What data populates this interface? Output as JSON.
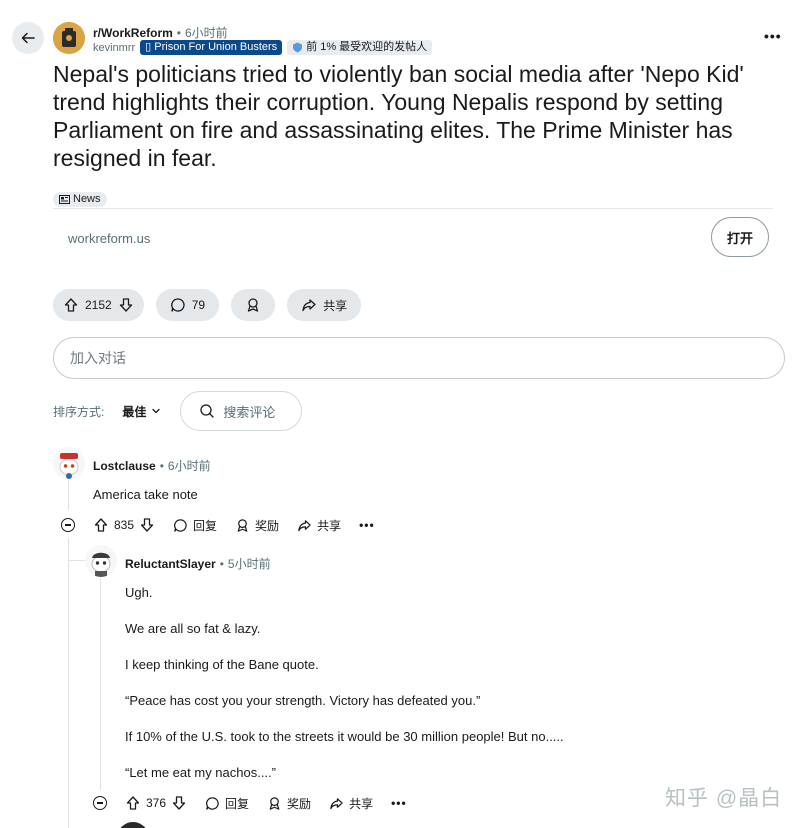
{
  "header": {
    "subreddit": "r/WorkReform",
    "separator": "•",
    "post_time": "6小时前",
    "author": "kevinmrr",
    "author_flair": "Prison For Union Busters",
    "author_badge": "前 1% 最受欢迎的发帖人"
  },
  "post": {
    "title": "Nepal's politicians tried to violently ban social media after 'Nepo Kid' trend highlights their corruption. Young Nepalis respond by setting Parliament on fire and assassinating elites. The Prime Minister has resigned in fear.",
    "flair": "News",
    "link_domain": "workreform.us",
    "open_label": "打开",
    "votes": "2152",
    "comments": "79",
    "share_label": "共享"
  },
  "comment_input": {
    "placeholder": "加入对话"
  },
  "sort": {
    "label": "排序方式:",
    "value": "最佳",
    "search_placeholder": "搜索评论"
  },
  "comments": [
    {
      "user": "Lostclause",
      "time": "6小时前",
      "lines": [
        "America take note"
      ],
      "votes": "835",
      "reply_label": "回复",
      "award_label": "奖励",
      "share_label": "共享"
    },
    {
      "user": "ReluctantSlayer",
      "time": "5小时前",
      "lines": [
        "Ugh.",
        "We are all so fat & lazy.",
        "I keep thinking of the Bane quote.",
        "“Peace has cost you your strength. Victory has defeated you.”",
        "If 10% of the U.S. took to the streets it would be 30 million people! But no.....",
        "“Let me eat my nachos....”"
      ],
      "votes": "376",
      "reply_label": "回复",
      "award_label": "奖励",
      "share_label": "共享"
    }
  ],
  "watermark": "知乎 @晶白",
  "colors": {
    "flair_blue": "#0a4a8c",
    "pill_bg": "#e5e8ea",
    "muted_text": "#576f76"
  }
}
